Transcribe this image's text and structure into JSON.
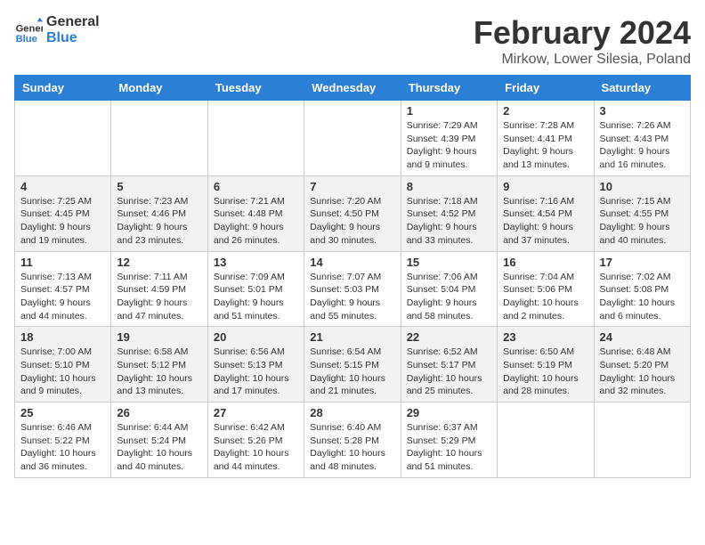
{
  "header": {
    "logo_text_general": "General",
    "logo_text_blue": "Blue",
    "month_year": "February 2024",
    "location": "Mirkow, Lower Silesia, Poland"
  },
  "weekdays": [
    "Sunday",
    "Monday",
    "Tuesday",
    "Wednesday",
    "Thursday",
    "Friday",
    "Saturday"
  ],
  "weeks": [
    [
      {
        "day": "",
        "info": ""
      },
      {
        "day": "",
        "info": ""
      },
      {
        "day": "",
        "info": ""
      },
      {
        "day": "",
        "info": ""
      },
      {
        "day": "1",
        "info": "Sunrise: 7:29 AM\nSunset: 4:39 PM\nDaylight: 9 hours\nand 9 minutes."
      },
      {
        "day": "2",
        "info": "Sunrise: 7:28 AM\nSunset: 4:41 PM\nDaylight: 9 hours\nand 13 minutes."
      },
      {
        "day": "3",
        "info": "Sunrise: 7:26 AM\nSunset: 4:43 PM\nDaylight: 9 hours\nand 16 minutes."
      }
    ],
    [
      {
        "day": "4",
        "info": "Sunrise: 7:25 AM\nSunset: 4:45 PM\nDaylight: 9 hours\nand 19 minutes."
      },
      {
        "day": "5",
        "info": "Sunrise: 7:23 AM\nSunset: 4:46 PM\nDaylight: 9 hours\nand 23 minutes."
      },
      {
        "day": "6",
        "info": "Sunrise: 7:21 AM\nSunset: 4:48 PM\nDaylight: 9 hours\nand 26 minutes."
      },
      {
        "day": "7",
        "info": "Sunrise: 7:20 AM\nSunset: 4:50 PM\nDaylight: 9 hours\nand 30 minutes."
      },
      {
        "day": "8",
        "info": "Sunrise: 7:18 AM\nSunset: 4:52 PM\nDaylight: 9 hours\nand 33 minutes."
      },
      {
        "day": "9",
        "info": "Sunrise: 7:16 AM\nSunset: 4:54 PM\nDaylight: 9 hours\nand 37 minutes."
      },
      {
        "day": "10",
        "info": "Sunrise: 7:15 AM\nSunset: 4:55 PM\nDaylight: 9 hours\nand 40 minutes."
      }
    ],
    [
      {
        "day": "11",
        "info": "Sunrise: 7:13 AM\nSunset: 4:57 PM\nDaylight: 9 hours\nand 44 minutes."
      },
      {
        "day": "12",
        "info": "Sunrise: 7:11 AM\nSunset: 4:59 PM\nDaylight: 9 hours\nand 47 minutes."
      },
      {
        "day": "13",
        "info": "Sunrise: 7:09 AM\nSunset: 5:01 PM\nDaylight: 9 hours\nand 51 minutes."
      },
      {
        "day": "14",
        "info": "Sunrise: 7:07 AM\nSunset: 5:03 PM\nDaylight: 9 hours\nand 55 minutes."
      },
      {
        "day": "15",
        "info": "Sunrise: 7:06 AM\nSunset: 5:04 PM\nDaylight: 9 hours\nand 58 minutes."
      },
      {
        "day": "16",
        "info": "Sunrise: 7:04 AM\nSunset: 5:06 PM\nDaylight: 10 hours\nand 2 minutes."
      },
      {
        "day": "17",
        "info": "Sunrise: 7:02 AM\nSunset: 5:08 PM\nDaylight: 10 hours\nand 6 minutes."
      }
    ],
    [
      {
        "day": "18",
        "info": "Sunrise: 7:00 AM\nSunset: 5:10 PM\nDaylight: 10 hours\nand 9 minutes."
      },
      {
        "day": "19",
        "info": "Sunrise: 6:58 AM\nSunset: 5:12 PM\nDaylight: 10 hours\nand 13 minutes."
      },
      {
        "day": "20",
        "info": "Sunrise: 6:56 AM\nSunset: 5:13 PM\nDaylight: 10 hours\nand 17 minutes."
      },
      {
        "day": "21",
        "info": "Sunrise: 6:54 AM\nSunset: 5:15 PM\nDaylight: 10 hours\nand 21 minutes."
      },
      {
        "day": "22",
        "info": "Sunrise: 6:52 AM\nSunset: 5:17 PM\nDaylight: 10 hours\nand 25 minutes."
      },
      {
        "day": "23",
        "info": "Sunrise: 6:50 AM\nSunset: 5:19 PM\nDaylight: 10 hours\nand 28 minutes."
      },
      {
        "day": "24",
        "info": "Sunrise: 6:48 AM\nSunset: 5:20 PM\nDaylight: 10 hours\nand 32 minutes."
      }
    ],
    [
      {
        "day": "25",
        "info": "Sunrise: 6:46 AM\nSunset: 5:22 PM\nDaylight: 10 hours\nand 36 minutes."
      },
      {
        "day": "26",
        "info": "Sunrise: 6:44 AM\nSunset: 5:24 PM\nDaylight: 10 hours\nand 40 minutes."
      },
      {
        "day": "27",
        "info": "Sunrise: 6:42 AM\nSunset: 5:26 PM\nDaylight: 10 hours\nand 44 minutes."
      },
      {
        "day": "28",
        "info": "Sunrise: 6:40 AM\nSunset: 5:28 PM\nDaylight: 10 hours\nand 48 minutes."
      },
      {
        "day": "29",
        "info": "Sunrise: 6:37 AM\nSunset: 5:29 PM\nDaylight: 10 hours\nand 51 minutes."
      },
      {
        "day": "",
        "info": ""
      },
      {
        "day": "",
        "info": ""
      }
    ]
  ]
}
